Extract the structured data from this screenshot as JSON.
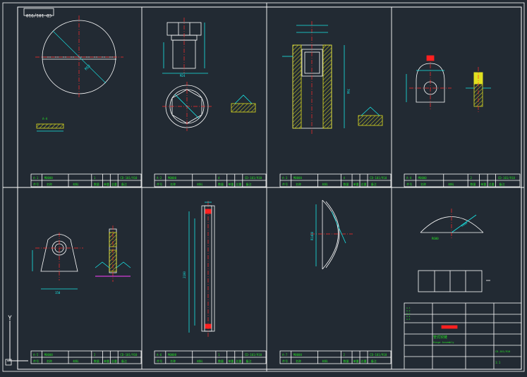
{
  "drawing": {
    "label": "CD-101/910",
    "colors": {
      "background": "#222a33",
      "frame": "#ffffff",
      "geometry": "#ffffff",
      "centerline": "#ff2a2a",
      "dimension": "#18e8e8",
      "text": "#27e027",
      "hatch": "#e0e020",
      "magenta": "#ff40ff",
      "red_block": "#ff2020"
    },
    "axis_icon": {
      "y": "Y",
      "x": "X"
    },
    "sheets": [
      {
        "part_no": "A-1",
        "part_name": "M0000",
        "qty": "1",
        "mat": "Q235-A",
        "code": "CD-101/910"
      },
      {
        "part_no": "A-2",
        "part_name": "M0000",
        "qty": "4",
        "mat": "Q235-A",
        "code": "CD-101/910"
      },
      {
        "part_no": "A-3",
        "part_name": "M0000",
        "qty": "4",
        "mat": "Q235-A",
        "code": "CD-101/910"
      },
      {
        "part_no": "A-4",
        "part_name": "M0000",
        "qty": "2",
        "mat": "Q235-A",
        "code": "CD-101/910"
      },
      {
        "part_no": "A-5",
        "part_name": "M0000",
        "qty": "2",
        "mat": "Q235-A",
        "code": "CD-101/910"
      },
      {
        "part_no": "A-6",
        "part_name": "M0000",
        "qty": "1",
        "mat": "Q235-A",
        "code": "CD-101/910"
      },
      {
        "part_no": "A-7",
        "part_name": "M0000",
        "qty": "2",
        "mat": "Q235-A",
        "code": "CD-101/910"
      }
    ],
    "table_headers": [
      "件号",
      "名称",
      "材料",
      "数量",
      "单重",
      "总重",
      "备注"
    ],
    "title_block": {
      "title": "管式铰链",
      "subtitle": "Hinge Assembly",
      "drawing_no": "CD-101/910",
      "scale": "1:1"
    }
  }
}
